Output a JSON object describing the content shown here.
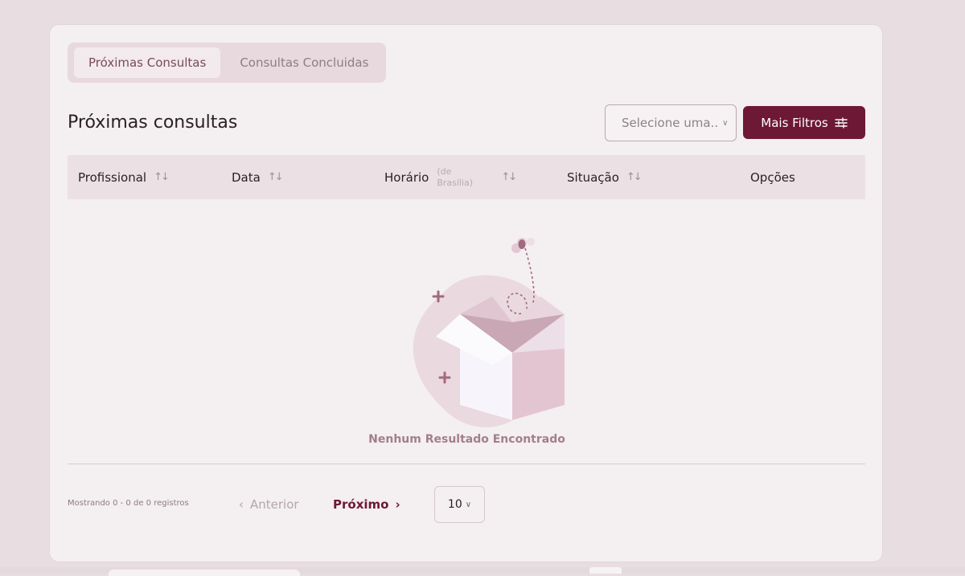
{
  "tabs": [
    {
      "label": "Próximas Consultas",
      "active": true
    },
    {
      "label": "Consultas Concluidas",
      "active": false
    }
  ],
  "section": {
    "title": "Próximas consultas"
  },
  "filters": {
    "select_placeholder": "Selecione uma..",
    "more_filters_label": "Mais Filtros"
  },
  "table": {
    "columns": [
      {
        "label": "Profissional",
        "sortable": true
      },
      {
        "label": "Data",
        "sortable": true
      },
      {
        "label": "Horário",
        "note": "(de Brasília)",
        "sortable": true
      },
      {
        "label": "Situação",
        "sortable": true
      },
      {
        "label": "Opções",
        "sortable": false
      }
    ],
    "rows": []
  },
  "empty": {
    "message": "Nenhum Resultado Encontrado"
  },
  "pagination": {
    "showing": "Mostrando 0 - 0 de 0 registros",
    "prev_label": "Anterior",
    "next_label": "Próximo",
    "page_size": "10"
  },
  "colors": {
    "accent": "#6d1834",
    "background": "#e8dde0",
    "card": "#f4eff1",
    "empty_text": "#a27f8d"
  }
}
